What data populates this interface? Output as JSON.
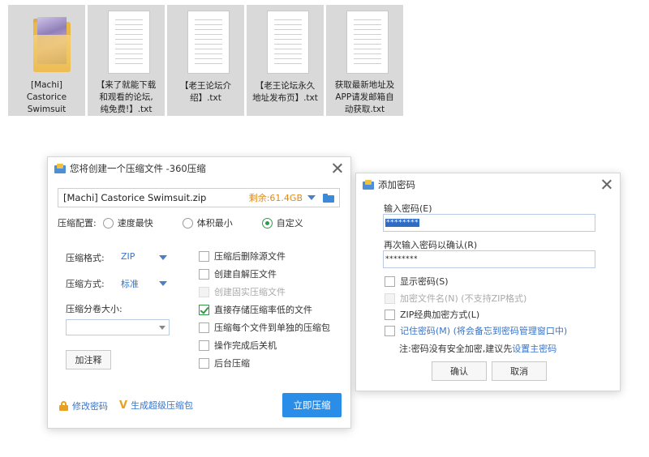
{
  "files": [
    {
      "type": "folder",
      "label": "[Machi]\nCastorice\nSwimsuit"
    },
    {
      "type": "text",
      "label": "【来了就能下载\n和观看的论坛,\n纯免费!】.txt"
    },
    {
      "type": "text",
      "label": "【老王论坛介\n绍】.txt"
    },
    {
      "type": "text",
      "label": "【老王论坛永久\n地址发布页】.txt"
    },
    {
      "type": "text",
      "label": "获取最新地址及\nAPP请发邮箱自\n动获取.txt"
    }
  ],
  "compress_dialog": {
    "title": "您将创建一个压缩文件 -360压缩",
    "filename": "[Machi] Castorice Swimsuit.zip",
    "free_space": "剩余:61.4GB",
    "config_label": "压缩配置:",
    "config_options": [
      "速度最快",
      "体积最小",
      "自定义"
    ],
    "config_selected": "自定义",
    "format_label": "压缩格式:",
    "format_value": "ZIP",
    "method_label": "压缩方式:",
    "method_value": "标准",
    "split_label": "压缩分卷大小:",
    "split_value": "",
    "comment_button": "加注释",
    "options": [
      {
        "label": "压缩后删除源文件",
        "checked": false,
        "disabled": false
      },
      {
        "label": "创建自解压文件",
        "checked": false,
        "disabled": false
      },
      {
        "label": "创建固实压缩文件",
        "checked": false,
        "disabled": true
      },
      {
        "label": "直接存储压缩率低的文件",
        "checked": true,
        "disabled": false
      },
      {
        "label": "压缩每个文件到单独的压缩包",
        "checked": false,
        "disabled": false
      },
      {
        "label": "操作完成后关机",
        "checked": false,
        "disabled": false
      },
      {
        "label": "后台压缩",
        "checked": false,
        "disabled": false
      }
    ],
    "change_password": "修改密码",
    "super_package": "生成超级压缩包",
    "compress_now": "立即压缩"
  },
  "password_dialog": {
    "title": "添加密码",
    "enter_label": "输入密码(E)",
    "enter_value": "********",
    "confirm_label": "再次输入密码以确认(R)",
    "confirm_value": "********",
    "show_password": "显示密码(S)",
    "encrypt_names": "加密文件名(N) (不支持ZIP格式)",
    "zip_classic": "ZIP经典加密方式(L)",
    "remember": "记住密码(M) (将会备忘到密码管理窗口中)",
    "note_prefix": "注:密码没有安全加密,建议先",
    "note_link": "设置主密码",
    "ok": "确认",
    "cancel": "取消"
  },
  "colors": {
    "accent": "#2a8ee8",
    "link": "#3a74c8",
    "free_space": "#e08a1a",
    "check": "#2f9b4a"
  }
}
